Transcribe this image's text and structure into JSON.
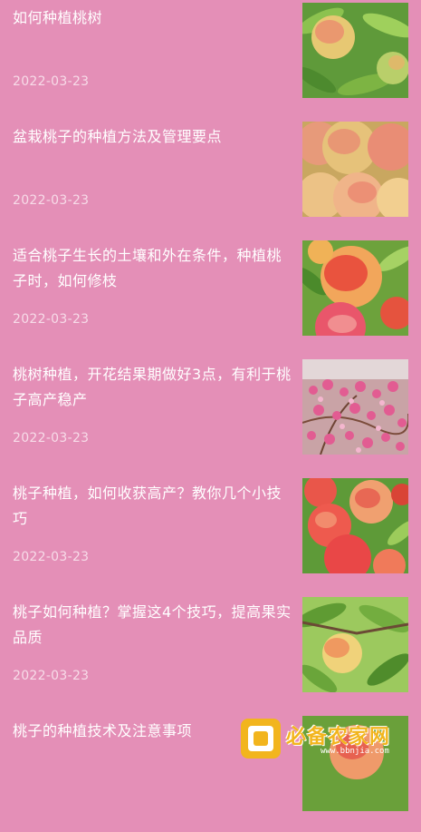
{
  "articles": [
    {
      "title": "如何种植桃树",
      "date": "2022-03-23",
      "image": "peach-tree-photo"
    },
    {
      "title": "盆栽桃子的种植方法及管理要点",
      "date": "2022-03-23",
      "image": "peaches-pile-photo"
    },
    {
      "title": "适合桃子生长的土壤和外在条件，种植桃子时，如何修枝",
      "date": "2022-03-23",
      "image": "red-peaches-photo"
    },
    {
      "title": "桃树种植，开花结果期做好3点，有利于桃子高产稳产",
      "date": "2022-03-23",
      "image": "peach-blossom-photo"
    },
    {
      "title": "桃子种植，如何收获高产？教你几个小技巧",
      "date": "2022-03-23",
      "image": "peach-cluster-photo"
    },
    {
      "title": "桃子如何种植？掌握这4个技巧，提高果实品质",
      "date": "2022-03-23",
      "image": "peach-on-branch-photo"
    },
    {
      "title": "桃子的种植技术及注意事项",
      "date": "",
      "image": "peach-photo-partial"
    }
  ],
  "watermark": {
    "text": "必备农家网",
    "url": "www.bbnjia.com"
  },
  "colors": {
    "background": "#e48fb7",
    "title": "#ffffff",
    "date": "#f7dbe8",
    "watermark": "#f2b51d"
  }
}
